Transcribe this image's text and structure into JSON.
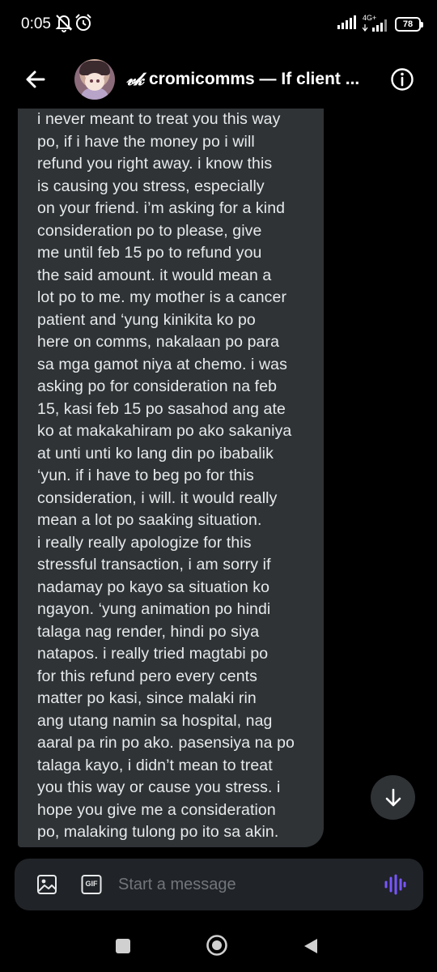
{
  "status_bar": {
    "time": "0:05",
    "network_label": "4G+",
    "battery_level": "78",
    "icons": [
      "mute-bell-icon",
      "alarm-icon",
      "signal-icon",
      "signal-icon",
      "battery-icon"
    ]
  },
  "header": {
    "name_mark": "𝓋𝓀",
    "title": "cromicomms — If client ...",
    "icons": [
      "back-arrow-icon",
      "info-icon"
    ]
  },
  "message": {
    "text": "i never meant to treat you this way\npo, if i have the money po i will\nrefund you right away. i know this\nis causing you stress, especially\non your friend. i’m asking for a kind\nconsideration po to please, give\nme until feb 15 po to refund you\nthe said amount. it would mean a\nlot po to me. my mother is a cancer\npatient and ‘yung kinikita ko po\nhere on comms, nakalaan po para\nsa mga gamot niya at chemo. i was\nasking po for consideration na feb\n15, kasi feb 15 po sasahod ang ate\nko at makakahiram po ako sakaniya\nat unti unti ko lang din po ibabalik\n‘yun. if i have to beg po for this\nconsideration, i will. it would really\nmean a lot po saaking situation.\ni really really apologize for this\nstressful transaction, i am sorry if\nnadamay po kayo sa situation ko\nngayon. ‘yung animation po hindi\ntalaga nag render, hindi po siya\nnatapos. i really tried magtabi po\nfor this refund pero every cents\nmatter po kasi, since malaki rin\nang utang namin sa hospital, nag\naaral pa rin po ako. pasensiya na po\ntalaga kayo, i didn’t mean to treat\nyou this way or cause you stress. i\nhope you give me a consideration\npo, malaking tulong po ito sa akin."
  },
  "composer": {
    "placeholder": "Start a message",
    "gif_label": "GIF",
    "icons": [
      "image-icon",
      "gif-icon",
      "voice-icon"
    ]
  },
  "colors": {
    "background": "#000000",
    "bubble": "#2f3336",
    "text": "#e7e9ea",
    "placeholder": "#71767b",
    "accent_voice": "#7856ff"
  },
  "nav": {
    "icons": [
      "recents-square-icon",
      "home-circle-icon",
      "back-triangle-icon"
    ]
  }
}
